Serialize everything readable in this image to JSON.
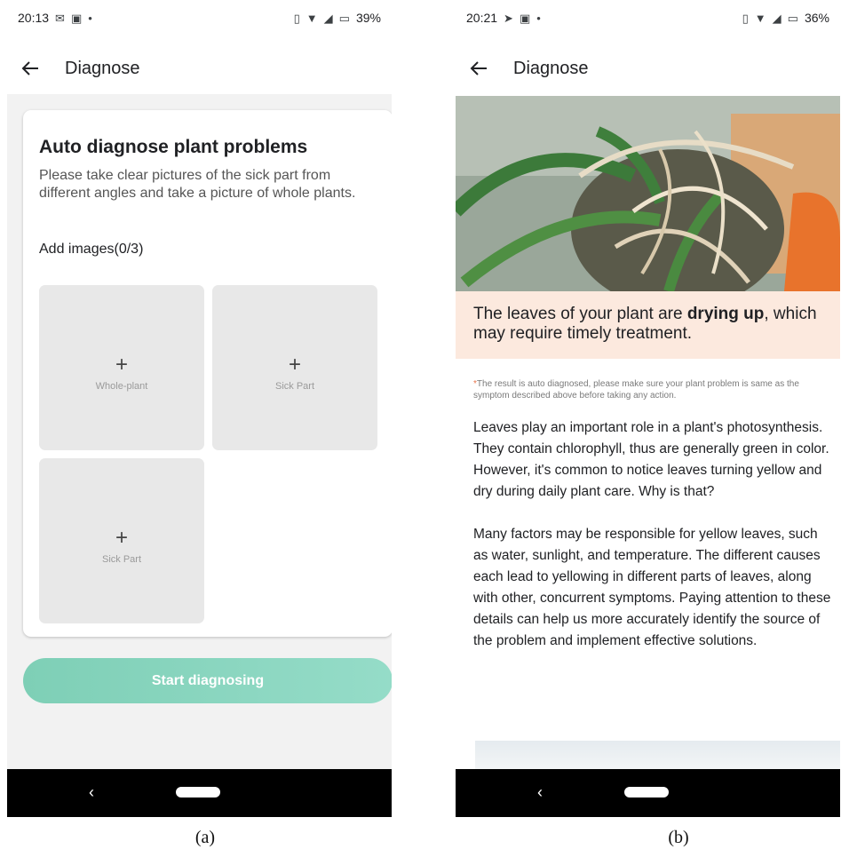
{
  "screen_a": {
    "status": {
      "time": "20:13",
      "battery": "39%"
    },
    "header": {
      "title": "Diagnose"
    },
    "card": {
      "title": "Auto diagnose plant problems",
      "description": "Please take clear pictures of the sick part from different angles and take a picture of whole plants.",
      "add_images_label": "Add images(0/3)",
      "slots": [
        {
          "plus": "+",
          "label": "Whole-plant"
        },
        {
          "plus": "+",
          "label": "Sick Part"
        },
        {
          "plus": "+",
          "label": "Sick Part"
        }
      ]
    },
    "start_button": "Start diagnosing",
    "nav": {
      "back": "‹"
    }
  },
  "screen_b": {
    "status": {
      "time": "20:21",
      "battery": "36%"
    },
    "header": {
      "title": "Diagnose"
    },
    "result": {
      "prefix": "The leaves of your plant are ",
      "emphasis": "drying up",
      "suffix": ", which may require timely treatment."
    },
    "note": {
      "asterisk": "*",
      "text": "The result is auto diagnosed, please make sure your plant problem is same as the symptom described above before taking any action."
    },
    "body": {
      "paragraph1": "Leaves play an important role in a plant's photosynthesis. They contain chlorophyll, thus are generally green in color. However, it's common to notice leaves turning yellow and dry during daily plant care. Why is that?",
      "paragraph2": "Many factors may be responsible for yellow leaves, such as water, sunlight, and temperature. The different causes each lead to yellowing in different parts of leaves, along with other, concurrent symptoms. Paying attention to these details can help us more accurately identify the source of the problem and implement effective solutions."
    },
    "nav": {
      "back": "‹"
    }
  },
  "captions": {
    "a": "(a)",
    "b": "(b)"
  },
  "icons": [
    "mail-icon",
    "video-icon",
    "send-icon",
    "vibrate-icon",
    "wifi-icon",
    "signal-icon",
    "battery-icon",
    "back-arrow-icon",
    "plus-icon"
  ],
  "colors": {
    "accent": "#8fd8c3",
    "banner_bg": "#fce9de",
    "asterisk": "#e8734a"
  }
}
